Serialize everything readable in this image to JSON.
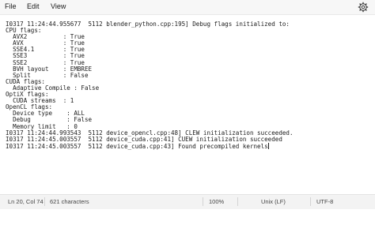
{
  "menu": {
    "file": "File",
    "edit": "Edit",
    "view": "View",
    "settings_icon": "gear-icon"
  },
  "editor": {
    "lines": [
      "I0317 11:24:44.955677  5112 blender_python.cpp:195] Debug flags initialized to:",
      "CPU flags:",
      "  AVX2          : True",
      "  AVX           : True",
      "  SSE4.1        : True",
      "  SSE3          : True",
      "  SSE2          : True",
      "  BVH layout    : EMBREE",
      "  Split         : False",
      "CUDA flags:",
      "  Adaptive Compile : False",
      "OptiX flags:",
      "  CUDA streams  : 1",
      "OpenCL flags:",
      "  Device type    : ALL",
      "  Debug          : False",
      "  Memory limit   : 0",
      "I0317 11:24:44.993543  5112 device_opencl.cpp:48] CLEW initialization succeeded.",
      "I0317 11:24:45.003557  5112 device_cuda.cpp:41] CUEW initialization succeeded",
      "I0317 11:24:45.003557  5112 device_cuda.cpp:43] Found precompiled kernels"
    ]
  },
  "status": {
    "position": "Ln 20, Col 74",
    "characters": "621 characters",
    "zoom": "100%",
    "line_ending": "Unix (LF)",
    "encoding": "UTF-8"
  }
}
